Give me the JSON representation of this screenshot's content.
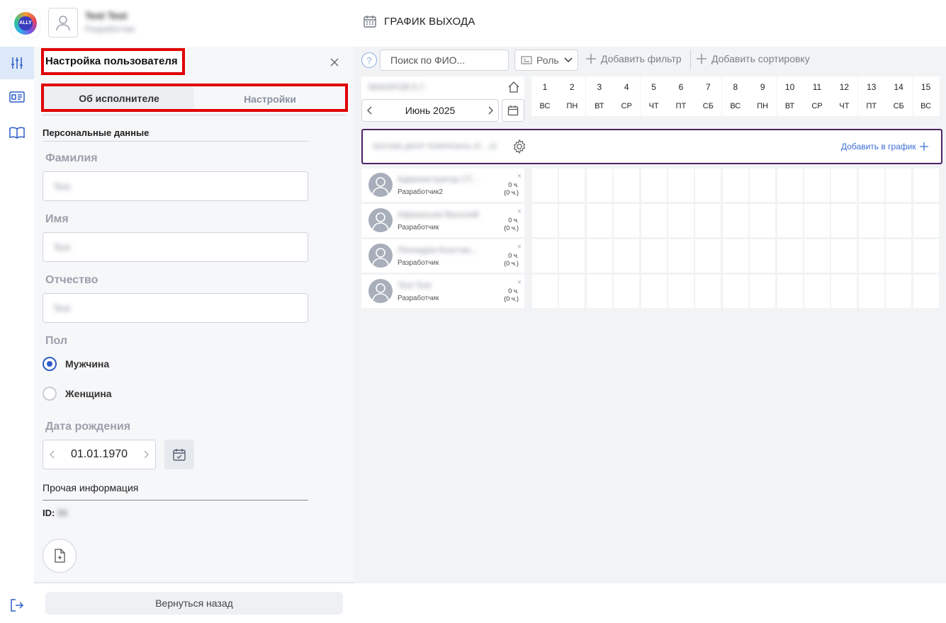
{
  "header": {
    "user_name": "Test Test",
    "user_role": "Разработчик",
    "page_title": "ГРАФИК ВЫХОДА"
  },
  "rail": {
    "items": [
      "settings-sliders-icon",
      "id-card-icon",
      "book-icon"
    ],
    "logout_icon": "logout-icon"
  },
  "panel": {
    "title": "Настройка пользователя",
    "tabs": [
      "Об исполнителе",
      "Настройки"
    ],
    "personal_section": "Персональные данные",
    "labels": {
      "last_name": "Фамилия",
      "first_name": "Имя",
      "patronymic": "Отчество",
      "gender": "Пол",
      "birth_date": "Дата рождения"
    },
    "values": {
      "last_name": "Test",
      "first_name": "Test",
      "patronymic": "Test"
    },
    "gender_options": [
      "Мужчина",
      "Женщина"
    ],
    "gender_selected": "Мужчина",
    "birth_date": "01.01.1970",
    "other_section": "Прочая информация",
    "id_label": "ID:",
    "id_value": "86",
    "back_button": "Вернуться назад"
  },
  "toolbar": {
    "help": "?",
    "search_placeholder": "Поиск по ФИО...",
    "role_filter": "Роль",
    "add_filter": "Добавить фильтр",
    "add_sort": "Добавить сортировку"
  },
  "schedule": {
    "org_name": "МАКАРОВ Е.Г.",
    "month": "Июнь 2025",
    "days": [
      {
        "n": "1",
        "w": "ВС"
      },
      {
        "n": "2",
        "w": "ПН"
      },
      {
        "n": "3",
        "w": "ВТ"
      },
      {
        "n": "4",
        "w": "СР"
      },
      {
        "n": "5",
        "w": "ЧТ"
      },
      {
        "n": "6",
        "w": "ПТ"
      },
      {
        "n": "7",
        "w": "СБ"
      },
      {
        "n": "8",
        "w": "ВС"
      },
      {
        "n": "9",
        "w": "ПН"
      },
      {
        "n": "10",
        "w": "ВТ"
      },
      {
        "n": "11",
        "w": "СР"
      },
      {
        "n": "12",
        "w": "ЧТ"
      },
      {
        "n": "13",
        "w": "ПТ"
      },
      {
        "n": "14",
        "w": "СБ"
      },
      {
        "n": "15",
        "w": "ВС"
      }
    ],
    "group_name": "МОСКВА ДФОР ПОМРАЧАНЬ 20 .. 18",
    "add_to_schedule": "Добавить в график",
    "employees": [
      {
        "name": "Администратор СТ...",
        "role": "Разработчик2",
        "hours": "0 ч.",
        "hours2": "(0 ч.)"
      },
      {
        "name": "Афанасьев Василий",
        "role": "Разработчик",
        "hours": "0 ч.",
        "hours2": "(0 ч.)"
      },
      {
        "name": "Леонидов Констан...",
        "role": "Разработчик",
        "hours": "0 ч.",
        "hours2": "(0 ч.)"
      },
      {
        "name": "Test Test",
        "role": "Разработчик",
        "hours": "0 ч.",
        "hours2": "(0 ч.)"
      }
    ],
    "remove_mark": "×"
  },
  "colors": {
    "accent": "#2d5cc8",
    "highlight_border": "#e00000",
    "group_border": "#4b2363",
    "link": "#3e6fd6"
  }
}
